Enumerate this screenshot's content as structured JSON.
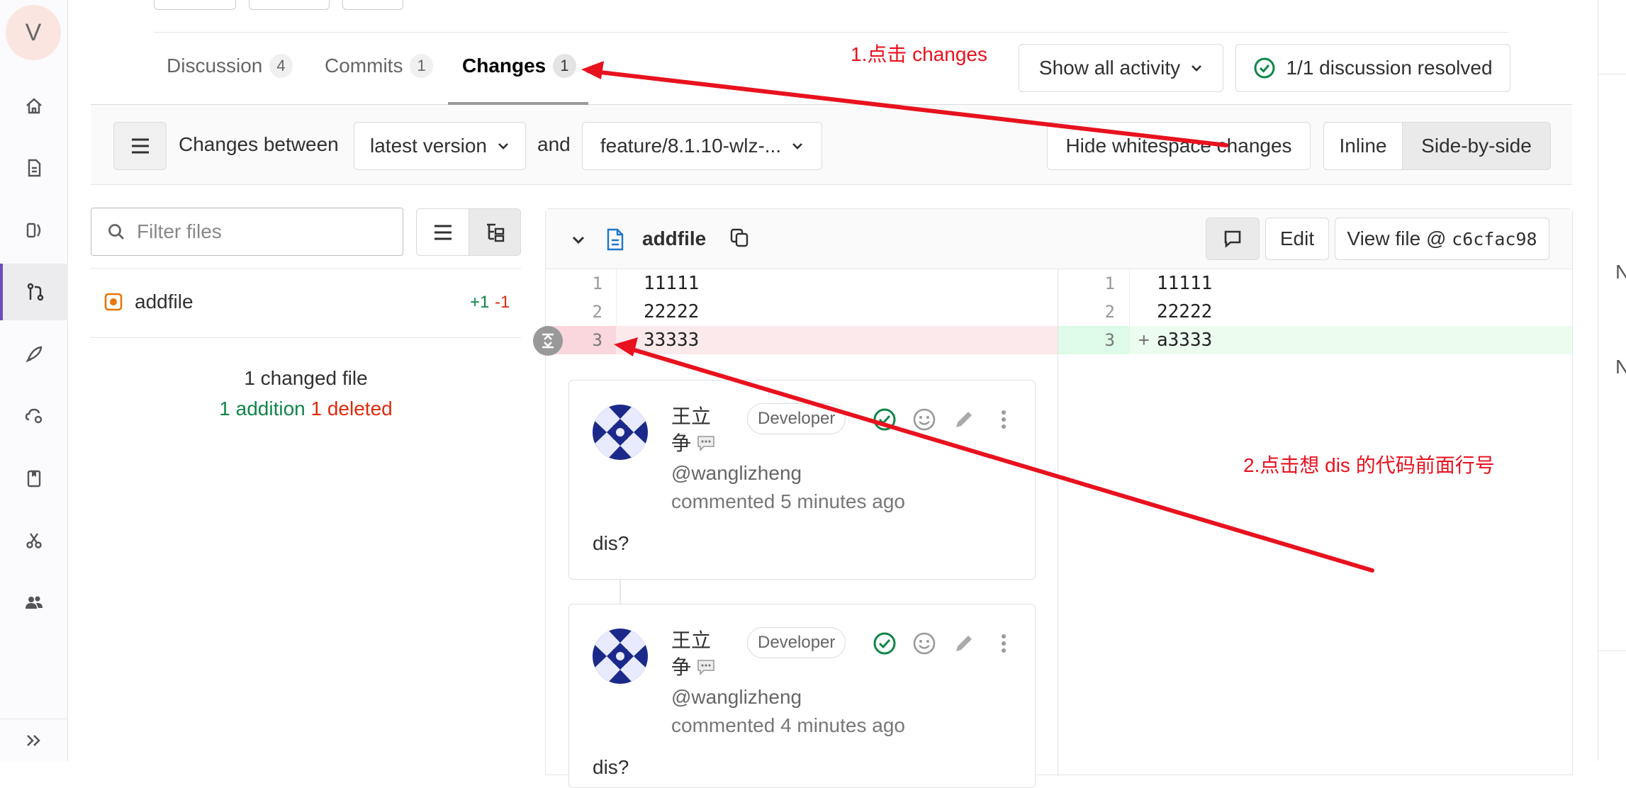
{
  "rail": {
    "avatar_letter": "V",
    "items": [
      "home-icon",
      "issues-icon",
      "repository-icon",
      "merge-request-icon",
      "deploy-icon",
      "settings-icon",
      "wiki-icon",
      "snippets-icon",
      "members-icon"
    ],
    "active_item": "merge-request-icon",
    "expand_icon": "double-chevron-right-icon"
  },
  "right_edge": {
    "letters": [
      "N",
      "N"
    ]
  },
  "tabs": [
    {
      "label": "Discussion",
      "count": "4"
    },
    {
      "label": "Commits",
      "count": "1"
    },
    {
      "label": "Changes",
      "count": "1",
      "active": true
    }
  ],
  "activity_filter": "Show all activity",
  "discussion_status": "1/1 discussion resolved",
  "toolbar": {
    "changes_between": "Changes between",
    "from_version": "latest version",
    "and_label": "and",
    "to_version": "feature/8.1.10-wlz-...",
    "hide_whitespace": "Hide whitespace changes",
    "inline": "Inline",
    "side_by_side": "Side-by-side"
  },
  "file_tree": {
    "filter_placeholder": "Filter files",
    "files": [
      {
        "name": "addfile",
        "added": "+1",
        "removed": "-1"
      }
    ],
    "summary": "1 changed file",
    "additions": "1 addition",
    "deletions": "1 deleted"
  },
  "diff": {
    "file_name": "addfile",
    "edit_label": "Edit",
    "view_file_label": "View file @ ",
    "commit_sha": "c6cfac98",
    "left_lines": [
      {
        "num": "1",
        "text": "11111"
      },
      {
        "num": "2",
        "text": "22222"
      },
      {
        "num": "3",
        "text": "33333",
        "type": "removed"
      }
    ],
    "right_lines": [
      {
        "num": "1",
        "text": "11111"
      },
      {
        "num": "2",
        "text": "22222"
      },
      {
        "num": "3",
        "text": "a3333",
        "type": "added",
        "marker": "+"
      }
    ]
  },
  "comments": [
    {
      "author": "王立争",
      "role": "Developer",
      "handle": "@wanglizheng",
      "time": "commented 5 minutes ago",
      "body": "dis?"
    },
    {
      "author": "王立争",
      "role": "Developer",
      "handle": "@wanglizheng",
      "time": "commented 4 minutes ago",
      "body": "dis?"
    }
  ],
  "annotations": {
    "step1": "1.点击 changes",
    "step2": "2.点击想 dis 的代码前面行号",
    "arrow_color": "#e8121e"
  },
  "colors": {
    "removed_bg": "#fbe9eb",
    "added_bg": "#ecfdf0",
    "resolved_green": "#108548",
    "accent": "#6b4fbb"
  }
}
